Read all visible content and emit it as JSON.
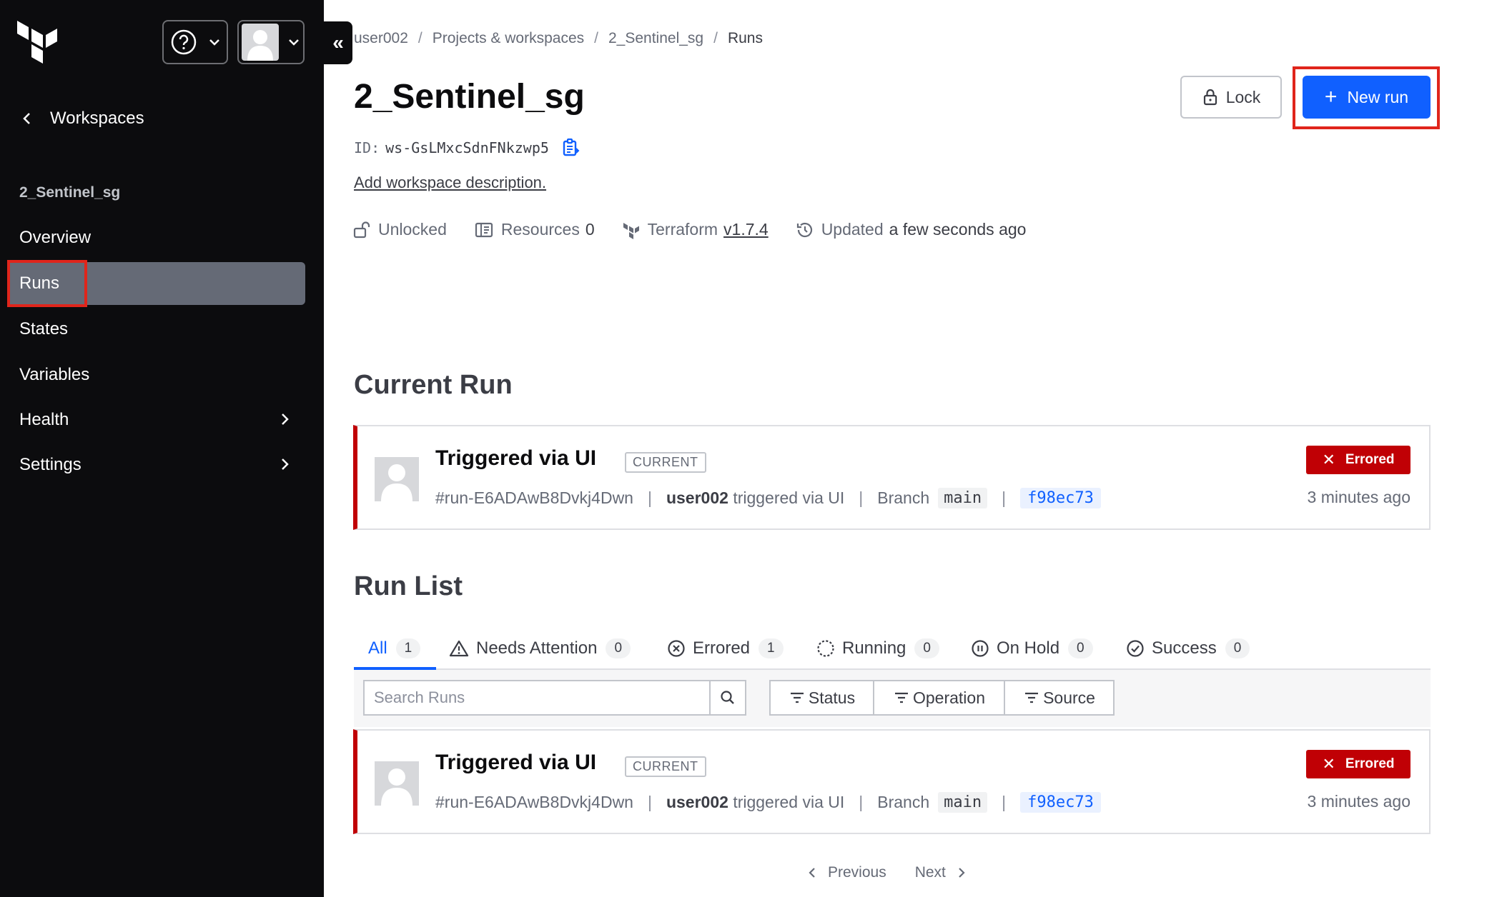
{
  "sidebar": {
    "back_label": "Workspaces",
    "workspace_name": "2_Sentinel_sg",
    "items": [
      {
        "label": "Overview"
      },
      {
        "label": "Runs",
        "active": true
      },
      {
        "label": "States"
      },
      {
        "label": "Variables"
      },
      {
        "label": "Health",
        "has_submenu": true
      },
      {
        "label": "Settings",
        "has_submenu": true
      }
    ]
  },
  "breadcrumb": [
    "user002",
    "Projects & workspaces",
    "2_Sentinel_sg",
    "Runs"
  ],
  "workspace": {
    "title": "2_Sentinel_sg",
    "id_label": "ID:",
    "id": "ws-GsLMxcSdnFNkzwp5",
    "add_description": "Add workspace description.",
    "lock_status": "Unlocked",
    "resources_label": "Resources",
    "resources_count": "0",
    "terraform_label": "Terraform",
    "terraform_version": "v1.7.4",
    "updated_label": "Updated",
    "updated_time": "a few seconds ago"
  },
  "actions": {
    "lock_label": "Lock",
    "new_run_label": "New run"
  },
  "current_run_title": "Current Run",
  "run_list_title": "Run List",
  "runs": [
    {
      "title": "Triggered via UI",
      "badge": "CURRENT",
      "run_id": "#run-E6ADAwB8Dvkj4Dwn",
      "user": "user002",
      "trigger_text": "triggered via UI",
      "branch_label": "Branch",
      "branch": "main",
      "commit": "f98ec73",
      "status": "Errored",
      "time": "3 minutes ago"
    }
  ],
  "tabs": [
    {
      "label": "All",
      "count": "1",
      "icon": "none"
    },
    {
      "label": "Needs Attention",
      "count": "0",
      "icon": "warning-icon"
    },
    {
      "label": "Errored",
      "count": "1",
      "icon": "x-circle-icon"
    },
    {
      "label": "Running",
      "count": "0",
      "icon": "loading-icon"
    },
    {
      "label": "On Hold",
      "count": "0",
      "icon": "pause-circle-icon"
    },
    {
      "label": "Success",
      "count": "0",
      "icon": "check-circle-icon"
    }
  ],
  "filters": {
    "search_placeholder": "Search Runs",
    "status": "Status",
    "operation": "Operation",
    "source": "Source"
  },
  "pagination": {
    "previous": "Previous",
    "next": "Next"
  },
  "colors": {
    "accent": "#1060ff",
    "error": "#c00005",
    "sidebar": "#0c0c0e",
    "highlight": "#e0251b"
  }
}
